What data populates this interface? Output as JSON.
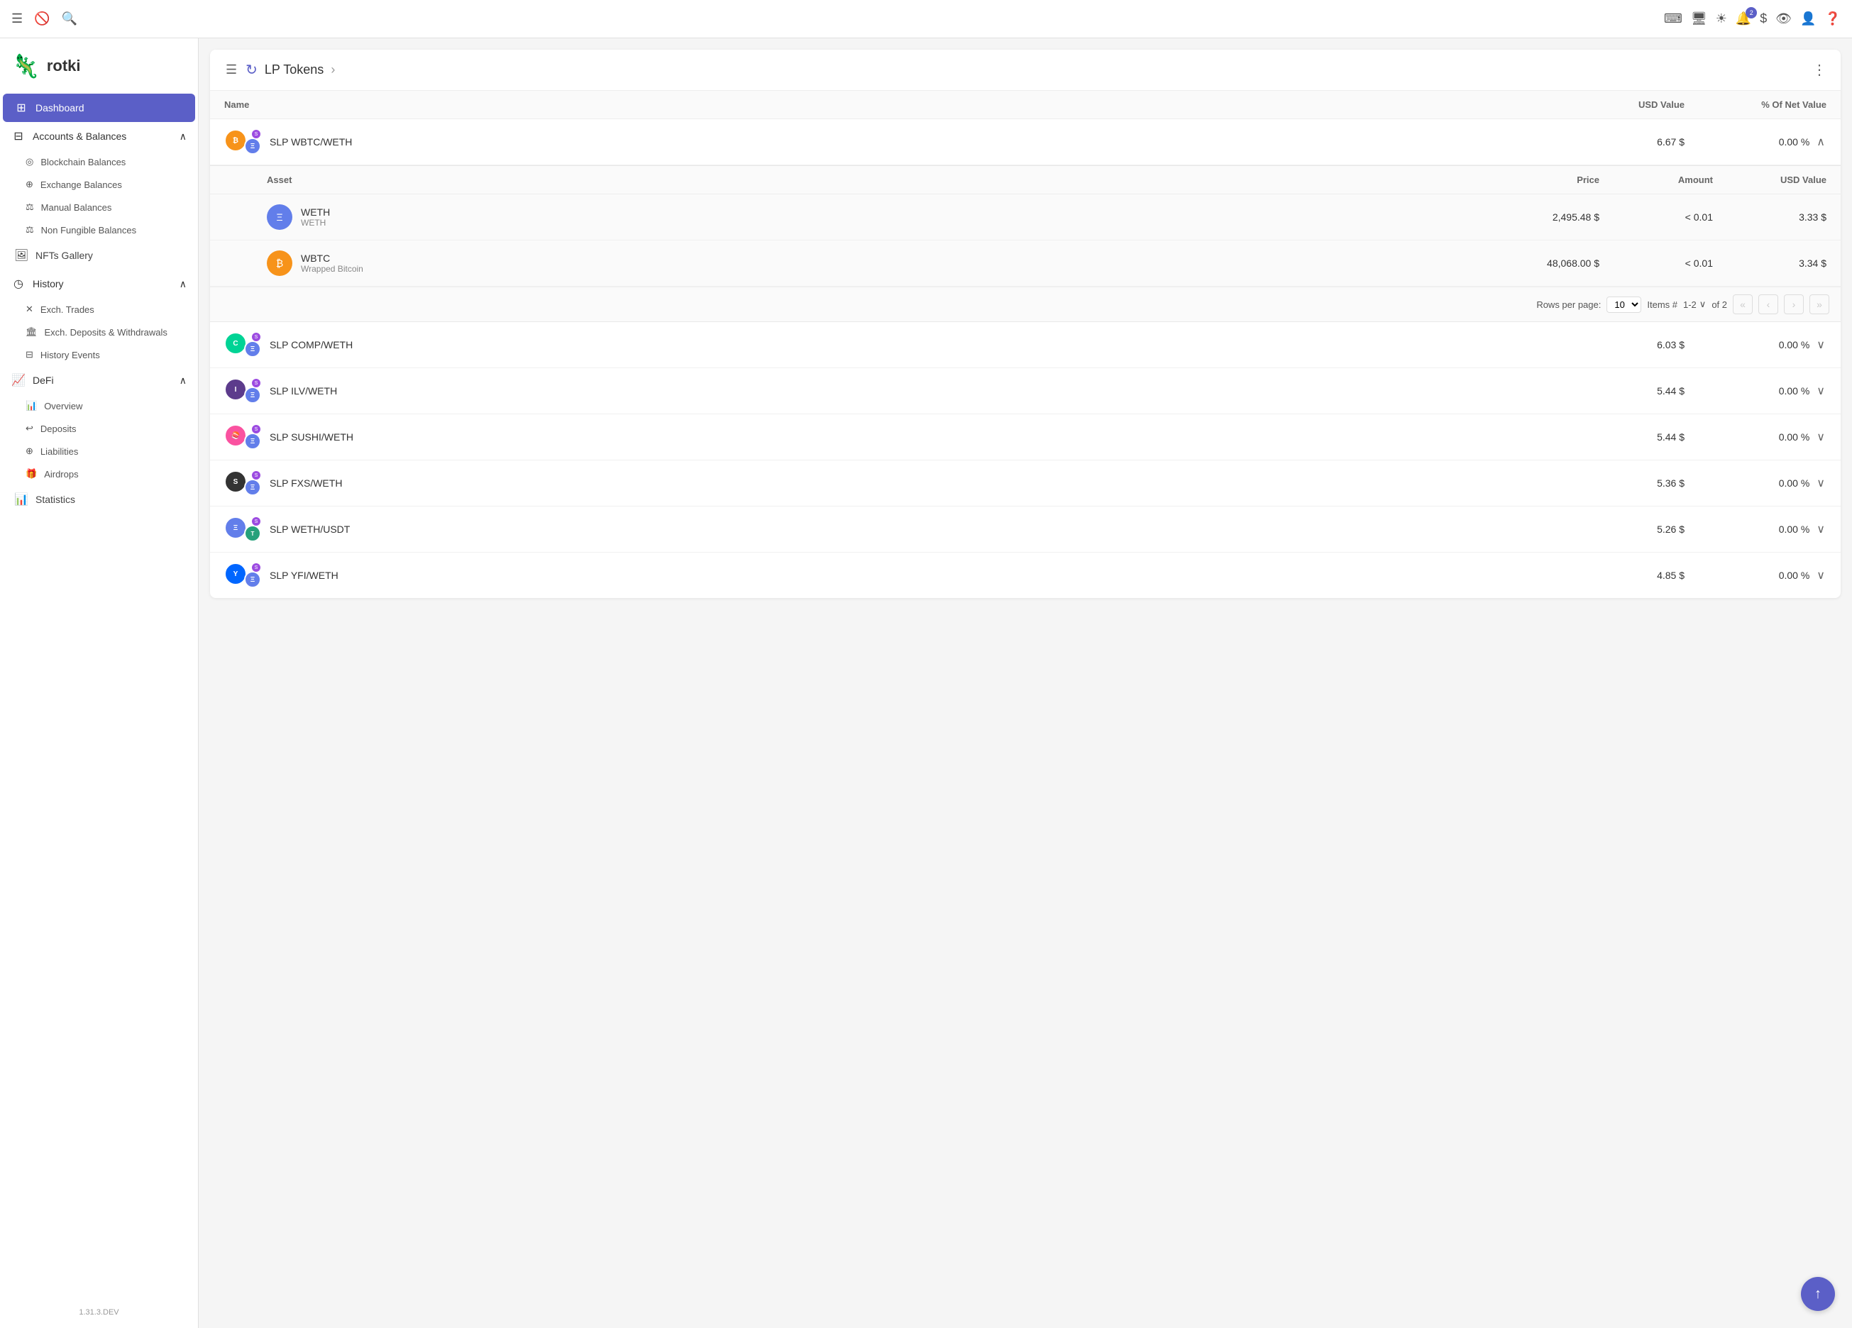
{
  "topbar": {
    "icons": [
      "menu",
      "no-ads",
      "search"
    ],
    "right_icons": [
      "code",
      "monitor",
      "theme",
      "notifications",
      "currency",
      "eye",
      "user",
      "help"
    ],
    "notification_count": "2"
  },
  "sidebar": {
    "logo": "rotki",
    "logo_emoji": "🦎",
    "nav_items": [
      {
        "id": "dashboard",
        "label": "Dashboard",
        "icon": "⊞",
        "active": true
      },
      {
        "id": "accounts-balances",
        "label": "Accounts & Balances",
        "icon": "⊟",
        "has_children": true,
        "expanded": true
      },
      {
        "id": "blockchain-balances",
        "label": "Blockchain Balances",
        "icon": "◎",
        "sub": true
      },
      {
        "id": "exchange-balances",
        "label": "Exchange Balances",
        "icon": "⊕",
        "sub": true
      },
      {
        "id": "manual-balances",
        "label": "Manual Balances",
        "icon": "⚖",
        "sub": true
      },
      {
        "id": "non-fungible-balances",
        "label": "Non Fungible Balances",
        "icon": "⚖",
        "sub": true
      },
      {
        "id": "nfts-gallery",
        "label": "NFTs Gallery",
        "icon": "🖼",
        "has_children": false
      },
      {
        "id": "history",
        "label": "History",
        "icon": "◷",
        "has_children": true,
        "expanded": true
      },
      {
        "id": "exch-trades",
        "label": "Exch. Trades",
        "icon": "✕",
        "sub": true
      },
      {
        "id": "exch-deposits",
        "label": "Exch. Deposits & Withdrawals",
        "icon": "⊞",
        "sub": true
      },
      {
        "id": "history-events",
        "label": "History Events",
        "icon": "⊟",
        "sub": true
      },
      {
        "id": "defi",
        "label": "DeFi",
        "icon": "📈",
        "has_children": true,
        "expanded": true
      },
      {
        "id": "overview",
        "label": "Overview",
        "icon": "📊",
        "sub": true
      },
      {
        "id": "deposits",
        "label": "Deposits",
        "icon": "↩",
        "sub": true
      },
      {
        "id": "liabilities",
        "label": "Liabilities",
        "icon": "⊕",
        "sub": true
      },
      {
        "id": "airdrops",
        "label": "Airdrops",
        "icon": "🎁",
        "sub": true
      },
      {
        "id": "statistics",
        "label": "Statistics",
        "icon": "📊"
      }
    ],
    "version": "1.31.3.DEV"
  },
  "panel": {
    "title": "LP Tokens",
    "refresh_icon": "↻",
    "columns": {
      "name": "Name",
      "usd_value": "USD Value",
      "net_value_pct": "% Of Net Value"
    },
    "sub_columns": {
      "asset": "Asset",
      "price": "Price",
      "amount": "Amount",
      "usd_value": "USD Value"
    },
    "rows": [
      {
        "id": "slp-wbtc-weth",
        "name": "SLP WBTC/WETH",
        "usd_value": "6.67 $",
        "net_value_pct": "0.00 %",
        "expanded": true,
        "tokens": [
          "BTC",
          "ETH"
        ],
        "assets": [
          {
            "name": "WETH",
            "symbol": "WETH",
            "price": "2,495.48 $",
            "amount": "< 0.01",
            "usd_value": "3.33 $"
          },
          {
            "name": "WBTC",
            "symbol": "Wrapped Bitcoin",
            "price": "48,068.00 $",
            "amount": "< 0.01",
            "usd_value": "3.34 $"
          }
        ],
        "pagination": {
          "rows_per_page_label": "Rows per page:",
          "rows_per_page": "10",
          "items_label": "Items #",
          "items_range": "1-2",
          "of_label": "of 2"
        }
      },
      {
        "id": "slp-comp-weth",
        "name": "SLP COMP/WETH",
        "usd_value": "6.03 $",
        "net_value_pct": "0.00 %",
        "expanded": false,
        "tokens": [
          "COMP",
          "ETH"
        ]
      },
      {
        "id": "slp-ilv-weth",
        "name": "SLP ILV/WETH",
        "usd_value": "5.44 $",
        "net_value_pct": "0.00 %",
        "expanded": false,
        "tokens": [
          "ILV",
          "ETH"
        ]
      },
      {
        "id": "slp-sushi-weth",
        "name": "SLP SUSHI/WETH",
        "usd_value": "5.44 $",
        "net_value_pct": "0.00 %",
        "expanded": false,
        "tokens": [
          "SUSHI",
          "ETH"
        ]
      },
      {
        "id": "slp-fxs-weth",
        "name": "SLP FXS/WETH",
        "usd_value": "5.36 $",
        "net_value_pct": "0.00 %",
        "expanded": false,
        "tokens": [
          "FXS",
          "ETH"
        ]
      },
      {
        "id": "slp-weth-usdt",
        "name": "SLP WETH/USDT",
        "usd_value": "5.26 $",
        "net_value_pct": "0.00 %",
        "expanded": false,
        "tokens": [
          "ETH",
          "USDT"
        ]
      },
      {
        "id": "slp-yfi-weth",
        "name": "SLP YFI/WETH",
        "usd_value": "4.85 $",
        "net_value_pct": "0.00 %",
        "expanded": false,
        "tokens": [
          "YFI",
          "ETH"
        ]
      }
    ]
  }
}
